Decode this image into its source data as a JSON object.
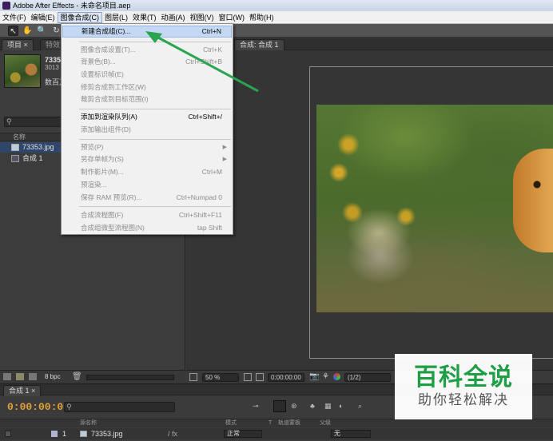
{
  "window": {
    "title": "Adobe After Effects - 未命名项目.aep"
  },
  "menubar": {
    "items": [
      "文件(F)",
      "编辑(E)",
      "图像合成(C)",
      "图层(L)",
      "效果(T)",
      "动画(A)",
      "视图(V)",
      "窗口(W)",
      "帮助(H)"
    ],
    "active_index": 2
  },
  "project_panel": {
    "tabs": [
      "项目",
      "特效"
    ],
    "selected_item": {
      "name": "73353",
      "meta": "3013",
      "info": "数百万"
    },
    "column_header": "名称",
    "items": [
      {
        "name": "73353.jpg",
        "type": "image"
      },
      {
        "name": "合成 1",
        "type": "composition"
      }
    ],
    "footer_bpc": "8 bpc"
  },
  "viewer": {
    "tab": "合成: 合成 1",
    "zoom": "50 %",
    "timecode": "0:00:00:00",
    "resolution": "(1/2)"
  },
  "dropdown_menu": {
    "items": [
      {
        "label": "新建合成组(C)...",
        "shortcut": "Ctrl+N",
        "enabled": true,
        "highlighted": true
      },
      {
        "sep": true
      },
      {
        "label": "图像合成设置(T)...",
        "shortcut": "Ctrl+K",
        "enabled": false
      },
      {
        "label": "背景色(B)...",
        "shortcut": "Ctrl+Shift+B",
        "enabled": false
      },
      {
        "label": "设置标识帧(E)",
        "shortcut": "",
        "enabled": false
      },
      {
        "label": "修剪合成到工作区(W)",
        "shortcut": "",
        "enabled": false
      },
      {
        "label": "裁剪合成到目标范围(I)",
        "shortcut": "",
        "enabled": false
      },
      {
        "sep": true
      },
      {
        "label": "添加到渲染队列(A)",
        "shortcut": "Ctrl+Shift+/",
        "enabled": true
      },
      {
        "label": "添加输出组件(D)",
        "shortcut": "",
        "enabled": false
      },
      {
        "sep": true
      },
      {
        "label": "预览(P)",
        "shortcut": "",
        "enabled": false,
        "submenu": true
      },
      {
        "label": "另存单帧为(S)",
        "shortcut": "",
        "enabled": false,
        "submenu": true
      },
      {
        "label": "制作影片(M)...",
        "shortcut": "Ctrl+M",
        "enabled": false
      },
      {
        "label": "预渲染...",
        "shortcut": "",
        "enabled": false
      },
      {
        "label": "保存 RAM 预览(R)...",
        "shortcut": "Ctrl+Numpad 0",
        "enabled": false
      },
      {
        "sep": true
      },
      {
        "label": "合成流程图(F)",
        "shortcut": "Ctrl+Shift+F11",
        "enabled": false
      },
      {
        "label": "合成组微型流程图(N)",
        "shortcut": "tap Shift",
        "enabled": false
      }
    ]
  },
  "timeline": {
    "tab": "合成 1",
    "timecode": "0:00:00:00",
    "columns": {
      "name": "源名称",
      "mode": "模式",
      "t": "T",
      "trkmat": "轨道蒙板",
      "parent": "父级"
    },
    "layer": {
      "index": "1",
      "name": "73353.jpg",
      "mode": "正常",
      "parent": "无"
    }
  },
  "watermark": {
    "title": "百科全说",
    "subtitle": "助你轻松解决"
  },
  "colors": {
    "accent_arrow": "#2aa44e",
    "timecode": "#e0a234",
    "menu_highlight": "#c5d8f3"
  }
}
